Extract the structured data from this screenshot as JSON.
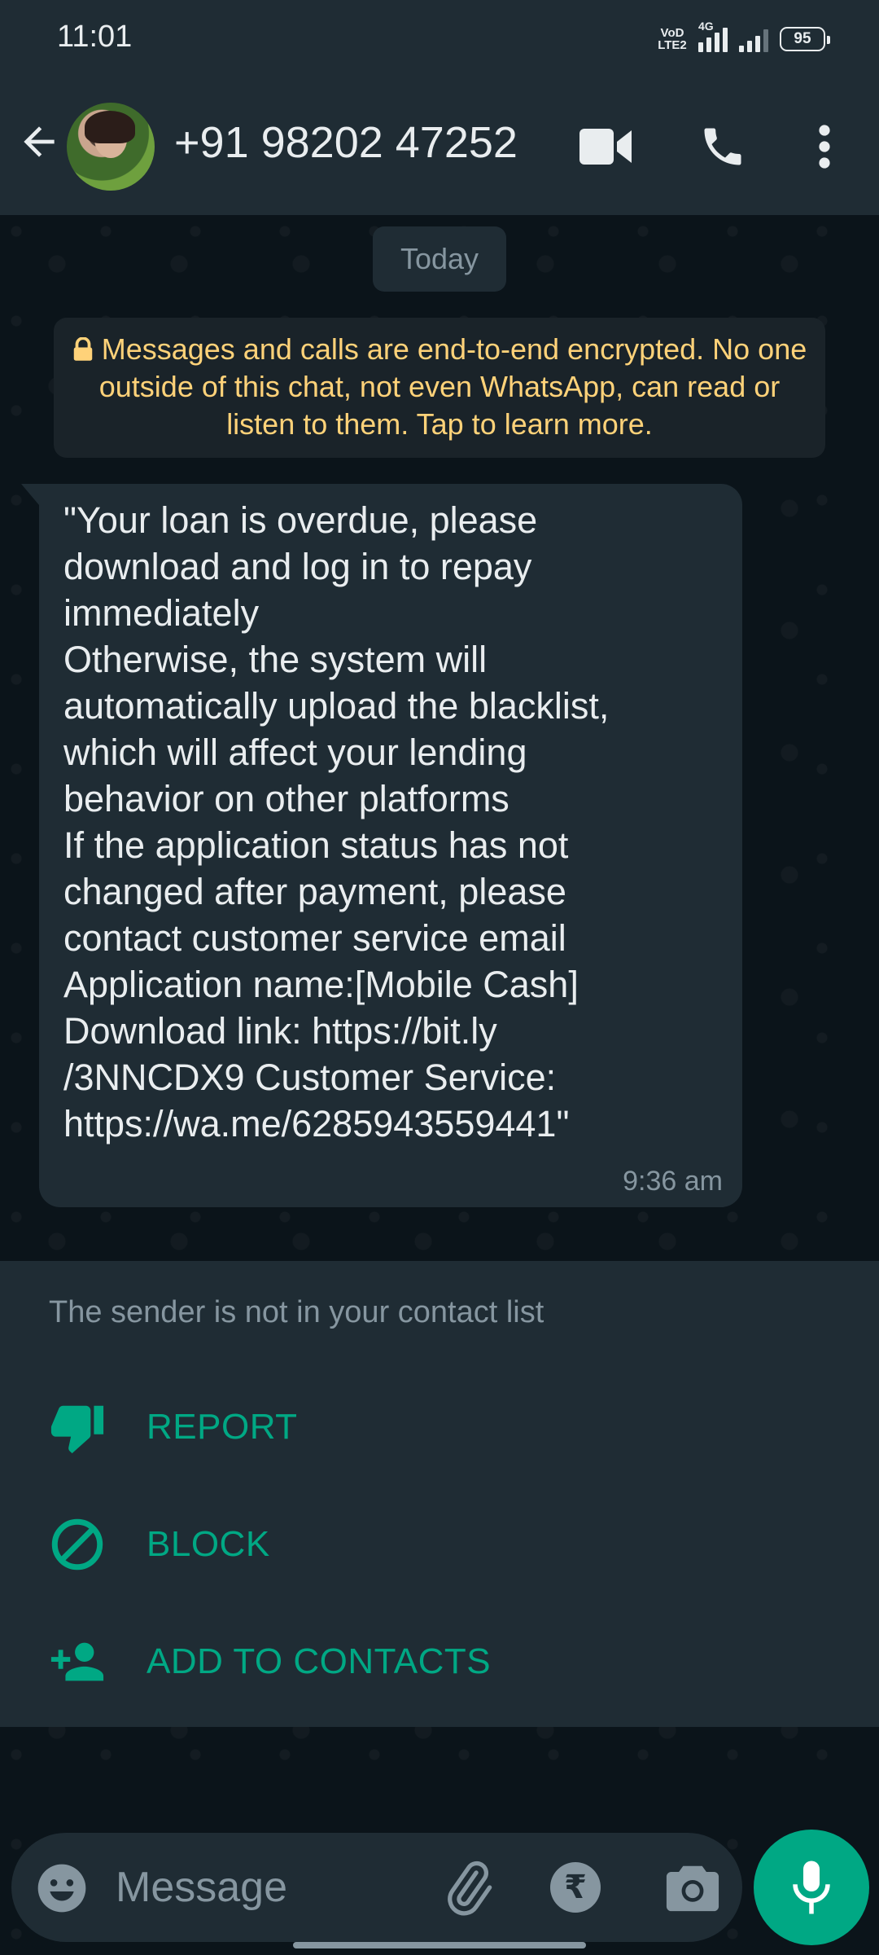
{
  "status_bar": {
    "time": "11:01",
    "volte_label": "VoD\nLTE2",
    "network_label": "4G",
    "battery": "95"
  },
  "header": {
    "contact_name": "+91 98202 47252",
    "icons": [
      "back-arrow-icon",
      "video-call-icon",
      "phone-icon",
      "more-options-icon"
    ]
  },
  "chat": {
    "date_chip": "Today",
    "encryption_notice": "Messages and calls are end-to-end encrypted. No one outside of this chat, not even WhatsApp, can read or listen to them. Tap to learn more.",
    "message": {
      "text": "\"Your loan is overdue, please\ndownload and log in to repay\nimmediately\nOtherwise, the system will\nautomatically upload the blacklist,\nwhich will affect your lending\nbehavior on other platforms\nIf the application status has not\nchanged after payment, please\ncontact customer service email\nApplication name:[Mobile Cash]\nDownload link: https://bit.ly\n/3NNCDX9 Customer Service:\nhttps://wa.me/6285943559441\"",
      "time": "9:36 am"
    }
  },
  "unknown_sender": {
    "notice": "The sender is not in your contact list",
    "actions": [
      {
        "label": "REPORT",
        "icon": "thumbs-down-icon"
      },
      {
        "label": "BLOCK",
        "icon": "block-icon"
      },
      {
        "label": "ADD TO CONTACTS",
        "icon": "add-contact-icon"
      }
    ]
  },
  "composer": {
    "placeholder": "Message",
    "rupee_symbol": "₹"
  },
  "colors": {
    "accent": "#00a884",
    "header_bg": "#1f2c34",
    "chat_bg": "#0b141a",
    "encryption_text": "#ffd279"
  }
}
